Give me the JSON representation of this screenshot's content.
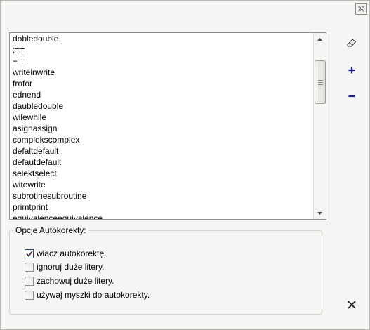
{
  "dialog": {
    "close_icon": "close-x-icon"
  },
  "wordlist": {
    "items": [
      "dobledouble",
      ";==",
      "+==",
      "writelnwrite",
      "frofor",
      "ednend",
      "daubledouble",
      "wilewhile",
      "asignassign",
      "complekscomplex",
      "defaltdefault",
      "defautdefault",
      "selektselect",
      "witewrite",
      "subrotinesubroutine",
      "primtprint",
      "equivalenceequivalence"
    ]
  },
  "toolbar": {
    "edit_icon": "eraser-icon",
    "add_icon": "plus-icon",
    "remove_icon": "minus-icon",
    "close_icon": "close-x-icon"
  },
  "options": {
    "group_label": "Opcje Autokorekty:",
    "checkboxes": [
      {
        "label": "włącz autokorektę.",
        "checked": true
      },
      {
        "label": "ignoruj duże litery.",
        "checked": false
      },
      {
        "label": "zachowuj duże litery.",
        "checked": false
      },
      {
        "label": "używaj myszki do autokorekty.",
        "checked": false
      }
    ]
  },
  "colors": {
    "accent": "#1a1a8c",
    "check_border": "#1c5180"
  }
}
